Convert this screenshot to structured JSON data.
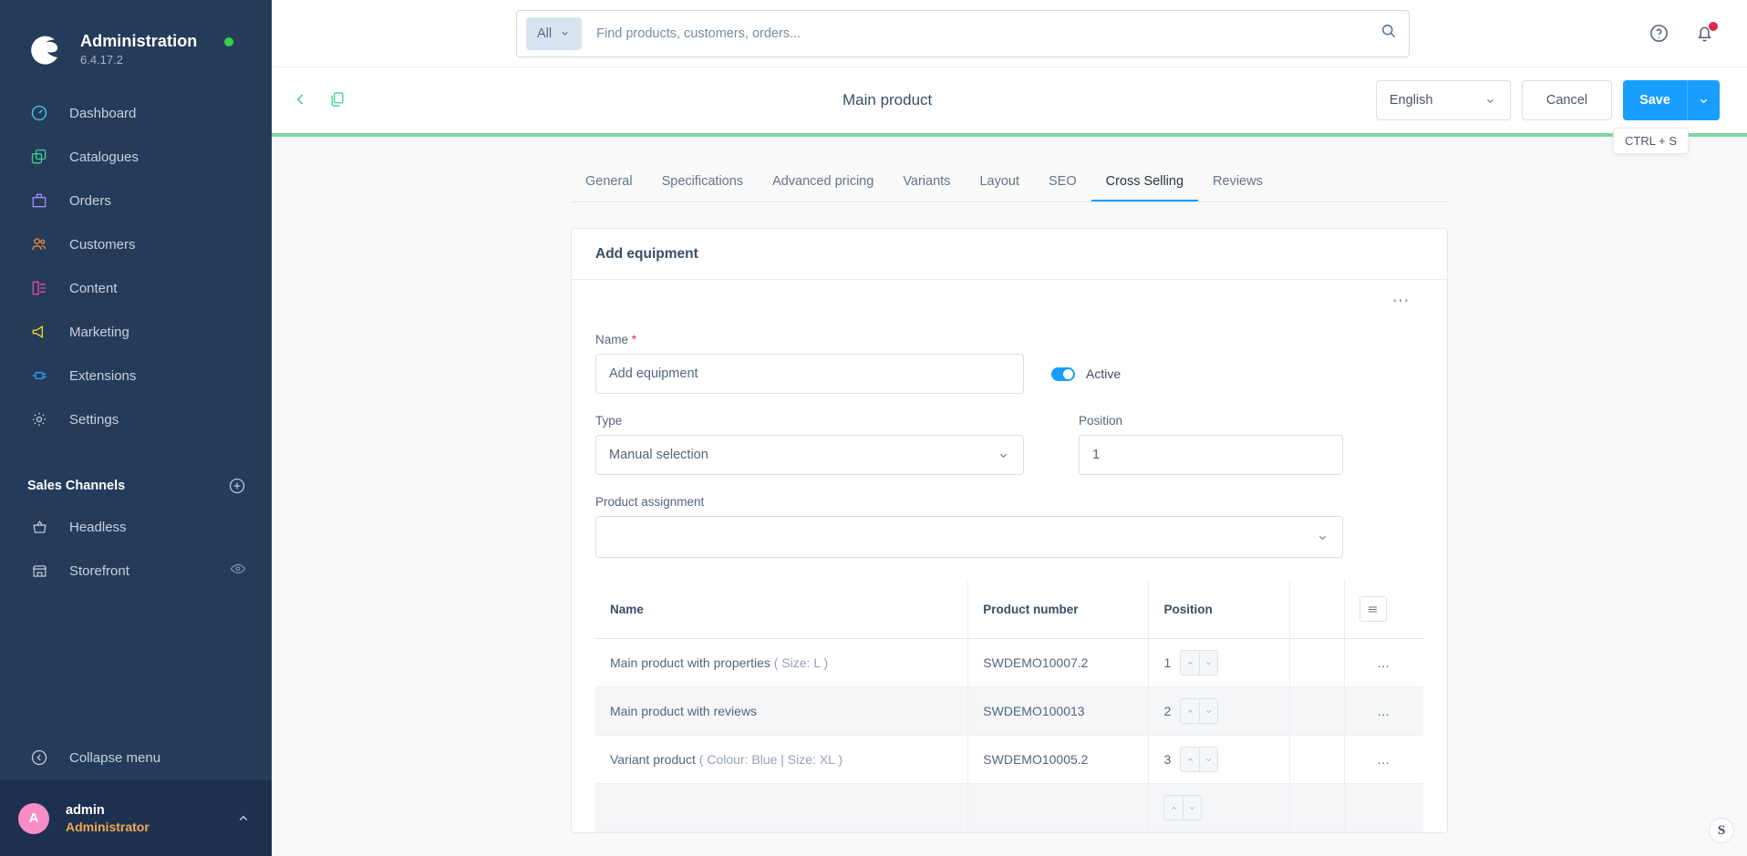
{
  "sidebar": {
    "brand": {
      "title": "Administration",
      "version": "6.4.17.2",
      "status_color": "#37d046"
    },
    "items": [
      {
        "label": "Dashboard",
        "icon": "dashboard-icon",
        "color": "#4dd0e8"
      },
      {
        "label": "Catalogues",
        "icon": "catalogues-icon",
        "color": "#3ecf8e"
      },
      {
        "label": "Orders",
        "icon": "orders-icon",
        "color": "#a58cf5"
      },
      {
        "label": "Customers",
        "icon": "customers-icon",
        "color": "#f08a3c"
      },
      {
        "label": "Content",
        "icon": "content-icon",
        "color": "#ec4899"
      },
      {
        "label": "Marketing",
        "icon": "marketing-icon",
        "color": "#ffd028"
      },
      {
        "label": "Extensions",
        "icon": "extensions-icon",
        "color": "#2e9df5"
      },
      {
        "label": "Settings",
        "icon": "settings-icon",
        "color": "#c4ccd8"
      }
    ],
    "sales_channels": {
      "title": "Sales Channels",
      "add_icon": "plus-circle-icon",
      "items": [
        {
          "label": "Headless",
          "icon": "basket-icon",
          "trailing_icon": ""
        },
        {
          "label": "Storefront",
          "icon": "storefront-icon",
          "trailing_icon": "eye-icon"
        }
      ]
    },
    "collapse": {
      "label": "Collapse menu",
      "icon": "collapse-icon"
    },
    "user": {
      "initial": "A",
      "name": "admin",
      "role": "Administrator",
      "avatar_color": "#f88cc4",
      "role_color": "#eeaa4e"
    }
  },
  "topbar": {
    "search": {
      "scope": "All",
      "placeholder": "Find products, customers, orders...",
      "value": "",
      "search_icon": "search-icon"
    },
    "help_icon": "help-circle-icon",
    "bell_icon": "bell-icon",
    "has_notification": true
  },
  "pagehead": {
    "back_icon": "chevron-left-icon",
    "duplicate_icon": "duplicate-icon",
    "title": "Main product",
    "language": "English",
    "cancel_label": "Cancel",
    "save_label": "Save",
    "save_tooltip": "CTRL + S",
    "accent_color": "#189eff",
    "progress_color": "#78d8a0"
  },
  "tabs": [
    {
      "label": "General",
      "active": false
    },
    {
      "label": "Specifications",
      "active": false
    },
    {
      "label": "Advanced pricing",
      "active": false
    },
    {
      "label": "Variants",
      "active": false
    },
    {
      "label": "Layout",
      "active": false
    },
    {
      "label": "SEO",
      "active": false
    },
    {
      "label": "Cross Selling",
      "active": true
    },
    {
      "label": "Reviews",
      "active": false
    }
  ],
  "card": {
    "title": "Add equipment",
    "context_menu_icon": "ellipsis-icon",
    "fields": {
      "name": {
        "label": "Name",
        "required_marker": "*",
        "value": "Add equipment",
        "placeholder": ""
      },
      "active": {
        "label": "Active",
        "checked": true
      },
      "type": {
        "label": "Type",
        "value": "Manual selection"
      },
      "position": {
        "label": "Position",
        "value": "1"
      },
      "product_assignment": {
        "label": "Product assignment",
        "value": ""
      }
    },
    "table": {
      "columns": [
        "Name",
        "Product number",
        "Position",
        "",
        ""
      ],
      "settings_icon": "list-settings-icon",
      "rows": [
        {
          "name": "Main product with properties",
          "variant": "( Size: L )",
          "number": "SWDEMO10007.2",
          "position": "1",
          "menu": "…"
        },
        {
          "name": "Main product with reviews",
          "variant": "",
          "number": "SWDEMO100013",
          "position": "2",
          "menu": "…"
        },
        {
          "name": "Variant product",
          "variant": "( Colour: Blue | Size: XL )",
          "number": "SWDEMO10005.2",
          "position": "3",
          "menu": "…"
        },
        {
          "name": "",
          "variant": "",
          "number": "",
          "position": "",
          "menu": ""
        }
      ]
    }
  },
  "footer": {
    "symfony_badge": "S"
  }
}
